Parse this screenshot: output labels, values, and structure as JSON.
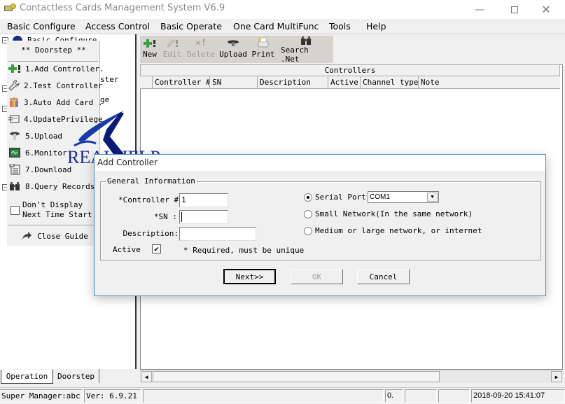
{
  "window": {
    "title": "Contactless Cards Management System  V6.9",
    "minimize_icon": "minimize-icon",
    "maximize_icon": "maximize-icon",
    "close_icon": "close-icon"
  },
  "menubar": {
    "items": [
      {
        "label": "Basic Configure"
      },
      {
        "label": "Access Control"
      },
      {
        "label": "Basic Operate"
      },
      {
        "label": "One Card MultiFunc"
      },
      {
        "label": "Tools"
      },
      {
        "label": "Help"
      }
    ]
  },
  "tree": {
    "root_label": "Basic Configure",
    "partial_items": [
      "ster",
      "ge"
    ]
  },
  "guide": {
    "title": "** Doorstep **",
    "items": [
      {
        "label": "1.Add Controller.",
        "icon": "add-controller-icon"
      },
      {
        "label": "2.Test Controller",
        "icon": "wrench-icon"
      },
      {
        "label": "3.Auto Add Card .",
        "icon": "people-icon"
      },
      {
        "label": "4.UpdatePrivilege",
        "icon": "update-icon"
      },
      {
        "label": "5.Upload",
        "icon": "upload-icon"
      },
      {
        "label": "6.Monitor",
        "icon": "monitor-icon"
      },
      {
        "label": "7.Download",
        "icon": "download-icon"
      },
      {
        "label": "8.Query Records",
        "icon": "binoculars-icon"
      }
    ],
    "dont_display_line1": "Don't Display",
    "dont_display_line2": "Next Time Start",
    "dont_display_checked": false,
    "close_label": "Close Guide"
  },
  "left_tabs": [
    {
      "label": "Operation",
      "active": false
    },
    {
      "label": "Doorstep",
      "active": true
    }
  ],
  "toolbar": {
    "buttons": [
      {
        "label": "New",
        "enabled": true
      },
      {
        "label": "Edit",
        "enabled": false
      },
      {
        "label": "Delete",
        "enabled": false
      },
      {
        "label": "Upload",
        "enabled": true
      },
      {
        "label": "Print",
        "enabled": true
      },
      {
        "label": "Search .Net",
        "enabled": true
      }
    ]
  },
  "grid": {
    "title": "Controllers",
    "columns": [
      "Controller #",
      "SN",
      "Description",
      "Active",
      "Channel type",
      "Note"
    ],
    "rows": []
  },
  "logo": {
    "text": "REALHELP"
  },
  "dialog": {
    "title": "Add Controller",
    "group_label": "General Information",
    "controller_label": "*Controller #:",
    "controller_value": "1",
    "sn_label": "*SN :",
    "sn_value": "",
    "description_label": "Description:",
    "description_value": "",
    "active_label": "Active",
    "active_checked": true,
    "required_note": "*  Required, must be unique",
    "connection_options": [
      {
        "label": "Serial Port",
        "checked": true
      },
      {
        "label": "Small Network(In the same network)",
        "checked": false
      },
      {
        "label": "Medium or large network, or internet",
        "checked": false
      }
    ],
    "serial_port_value": "COM1",
    "next_label": "Next>>",
    "ok_label": "OK",
    "cancel_label": "Cancel"
  },
  "statusbar": {
    "user": "Super Manager:abc",
    "version": "Ver: 6.9.21",
    "cell3": "",
    "cell4": "0.",
    "cell5": "",
    "cell6": "",
    "datetime": "2018-09-20 15:41:07"
  }
}
